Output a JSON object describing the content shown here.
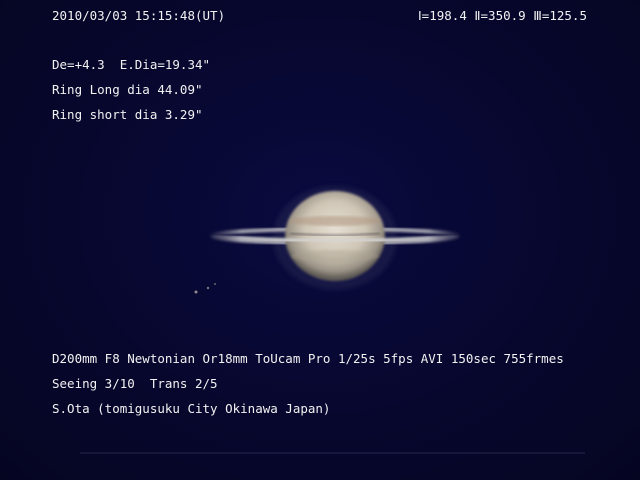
{
  "header": {
    "datetime": "2010/03/03 15:15:48(UT)",
    "longitudes": "Ⅰ=198.4 Ⅱ=350.9 Ⅲ=125.5"
  },
  "measurements": {
    "line1": "De=+4.3  E.Dia=19.34\"",
    "line2": "Ring Long dia 44.09\"",
    "line3": "Ring short dia 3.29\""
  },
  "footer": {
    "equipment": "D200mm F8 Newtonian Or18mm ToUcam Pro 1/25s 5fps AVI 150sec 755frmes",
    "conditions": "Seeing 3/10  Trans 2/5",
    "observer": "S.Ota (tomigusuku City Okinawa Japan)"
  },
  "colors": {
    "background": "#07072e",
    "planet_center": "#d8d2c4",
    "planet_band": "#b89e86",
    "ring": "#c9c7c6"
  }
}
